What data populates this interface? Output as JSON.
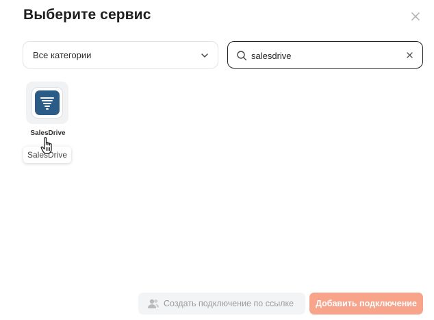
{
  "dialog": {
    "title": "Выберите сервис"
  },
  "filters": {
    "category_value": "Все категории",
    "search_value": "salesdrive"
  },
  "results": [
    {
      "name": "SalesDrive",
      "tooltip": "SalesDrive",
      "logo_color": "#2b5b87"
    }
  ],
  "footer": {
    "link_button_label": "Создать подключение по ссылке",
    "add_button_label": "Добавить подключение"
  },
  "colors": {
    "accent_disabled": "#f8a48b",
    "secondary_bg": "#f3f4f5"
  },
  "icons": [
    "close-icon",
    "chevron-down-icon",
    "search-icon",
    "clear-icon",
    "users-icon",
    "hand-cursor-icon"
  ]
}
